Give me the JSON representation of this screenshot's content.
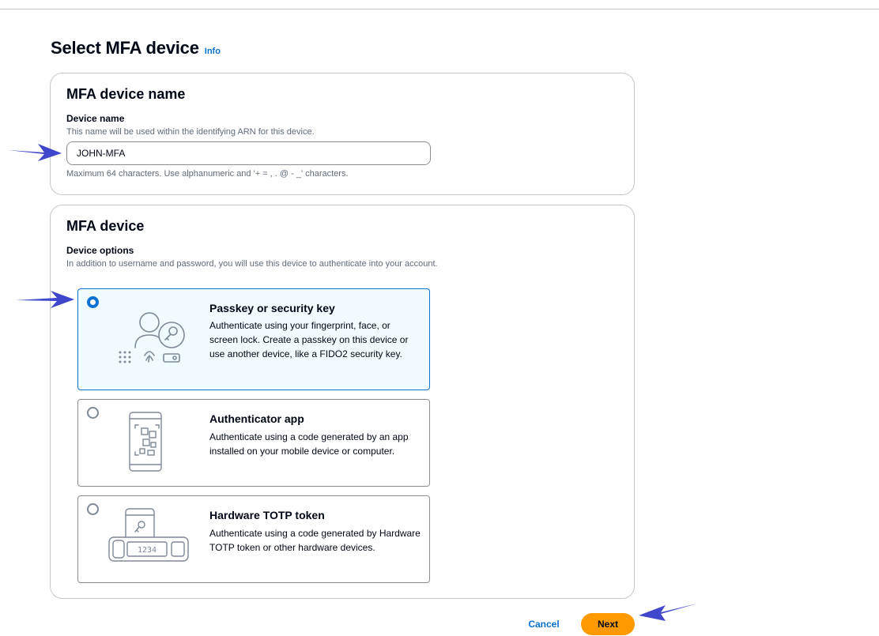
{
  "page": {
    "title": "Select MFA device",
    "info_label": "Info"
  },
  "name_panel": {
    "heading": "MFA device name",
    "field_label": "Device name",
    "field_description": "This name will be used within the identifying ARN for this device.",
    "input_value": "JOHN-MFA",
    "constraint": "Maximum 64 characters. Use alphanumeric and '+ = , . @ - _' characters."
  },
  "device_panel": {
    "heading": "MFA device",
    "field_label": "Device options",
    "field_description": "In addition to username and password, you will use this device to authenticate into your account.",
    "options": [
      {
        "title": "Passkey or security key",
        "description": "Authenticate using your fingerprint, face, or screen lock. Create a passkey on this device or use another device, like a FIDO2 security key.",
        "selected": true,
        "icon": "passkey-illustration-icon"
      },
      {
        "title": "Authenticator app",
        "description": "Authenticate using a code generated by an app installed on your mobile device or computer.",
        "selected": false,
        "icon": "authenticator-app-illustration-icon"
      },
      {
        "title": "Hardware TOTP token",
        "description": "Authenticate using a code generated by Hardware TOTP token or other hardware devices.",
        "selected": false,
        "icon": "hardware-token-illustration-icon"
      }
    ]
  },
  "token_display": "1234",
  "actions": {
    "cancel_label": "Cancel",
    "next_label": "Next"
  },
  "colors": {
    "accent": "#0972d3",
    "primary_button": "#ff9900",
    "annotation_arrow": "#3f47cc"
  }
}
